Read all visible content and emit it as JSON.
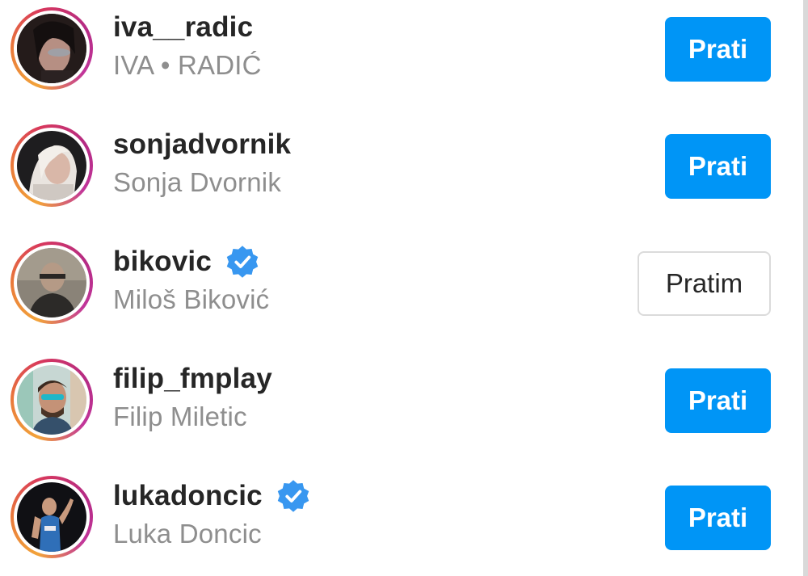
{
  "users": [
    {
      "username": "iva__radic",
      "full_name": "IVA • RADIĆ",
      "verified": false,
      "button_label": "Prati",
      "button_state": "follow",
      "avatar_icon": "avatar-photo"
    },
    {
      "username": "sonjadvornik",
      "full_name": "Sonja Dvornik",
      "verified": false,
      "button_label": "Prati",
      "button_state": "follow",
      "avatar_icon": "avatar-photo"
    },
    {
      "username": "bikovic",
      "full_name": "Miloš Biković",
      "verified": true,
      "button_label": "Pratim",
      "button_state": "following",
      "avatar_icon": "avatar-photo"
    },
    {
      "username": "filip_fmplay",
      "full_name": "Filip Miletic",
      "verified": false,
      "button_label": "Prati",
      "button_state": "follow",
      "avatar_icon": "avatar-photo"
    },
    {
      "username": "lukadoncic",
      "full_name": "Luka Doncic",
      "verified": true,
      "button_label": "Prati",
      "button_state": "follow",
      "avatar_icon": "avatar-photo"
    }
  ],
  "colors": {
    "follow_button": "#0095f6",
    "username_text": "#262626",
    "secondary_text": "#8e8e8e",
    "verified_badge": "#3897f0",
    "story_ring_start": "#f2a33a",
    "story_ring_end": "#b52b84"
  }
}
